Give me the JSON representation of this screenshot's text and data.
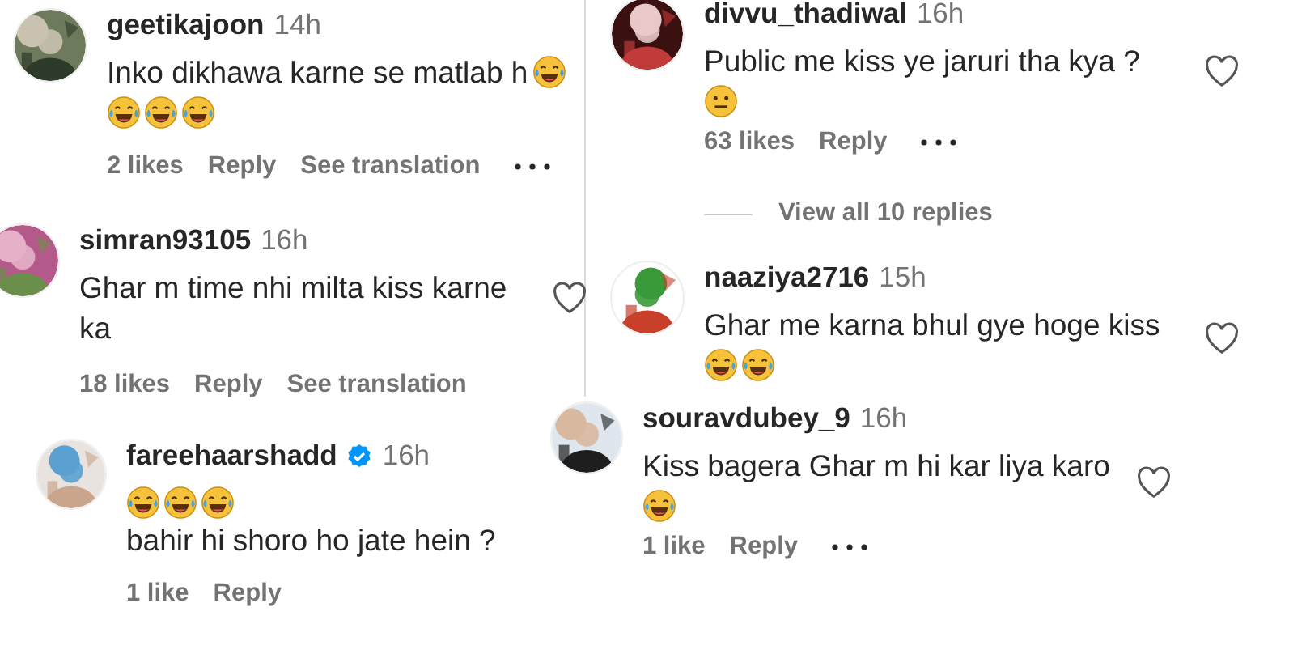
{
  "columns": [
    {
      "comments": [
        {
          "user": "geetikajoon",
          "time": "14h",
          "verified": false,
          "lines": [
            [
              {
                "kind": "text",
                "text": "Inko dikhawa karne se matlab h"
              },
              {
                "kind": "laugh"
              }
            ],
            [
              {
                "kind": "laugh"
              },
              {
                "kind": "laugh"
              },
              {
                "kind": "laugh"
              }
            ]
          ],
          "actions": [
            {
              "kind": "likes",
              "text": "2 likes"
            },
            {
              "kind": "reply",
              "text": "Reply"
            },
            {
              "kind": "translate",
              "text": "See translation"
            },
            {
              "kind": "more"
            }
          ]
        },
        {
          "user": "simran93105",
          "time": "16h",
          "verified": false,
          "liked": false,
          "lines": [
            [
              {
                "kind": "text",
                "text": "Ghar m time nhi milta kiss karne ka"
              }
            ]
          ],
          "actions": [
            {
              "kind": "likes",
              "text": "18 likes"
            },
            {
              "kind": "reply",
              "text": "Reply"
            },
            {
              "kind": "translate",
              "text": "See translation"
            }
          ]
        },
        {
          "user": "fareehaarshadd",
          "time": "16h",
          "verified": true,
          "lines": [
            [
              {
                "kind": "laugh"
              },
              {
                "kind": "laugh"
              },
              {
                "kind": "laugh"
              },
              {
                "kind": "text",
                "text": "bahir hi shoro ho jate hein ?"
              }
            ]
          ],
          "actions": [
            {
              "kind": "likes",
              "text": "1 like"
            },
            {
              "kind": "reply",
              "text": "Reply"
            }
          ]
        }
      ]
    },
    {
      "comments": [
        {
          "user": "divvu_thadiwal",
          "time": "16h",
          "verified": false,
          "liked": false,
          "lines": [
            [
              {
                "kind": "text",
                "text": "Public me kiss ye jaruri tha kya ?"
              }
            ],
            [
              {
                "kind": "neutral"
              }
            ]
          ],
          "actions": [
            {
              "kind": "likes",
              "text": "63 likes"
            },
            {
              "kind": "reply",
              "text": "Reply"
            },
            {
              "kind": "more"
            }
          ],
          "view_replies": "View all 10 replies"
        },
        {
          "user": "naaziya2716",
          "time": "15h",
          "verified": false,
          "liked": false,
          "lines": [
            [
              {
                "kind": "text",
                "text": "Ghar me karna bhul gye hoge kiss"
              }
            ],
            [
              {
                "kind": "laugh"
              },
              {
                "kind": "laugh"
              }
            ]
          ]
        },
        {
          "user": "souravdubey_9",
          "time": "16h",
          "verified": false,
          "liked": false,
          "lines": [
            [
              {
                "kind": "text",
                "text": "Kiss bagera Ghar m hi kar liya karo"
              }
            ],
            [
              {
                "kind": "laugh"
              }
            ]
          ],
          "actions": [
            {
              "kind": "likes",
              "text": "1 like"
            },
            {
              "kind": "reply",
              "text": "Reply"
            },
            {
              "kind": "more"
            }
          ]
        }
      ]
    }
  ]
}
